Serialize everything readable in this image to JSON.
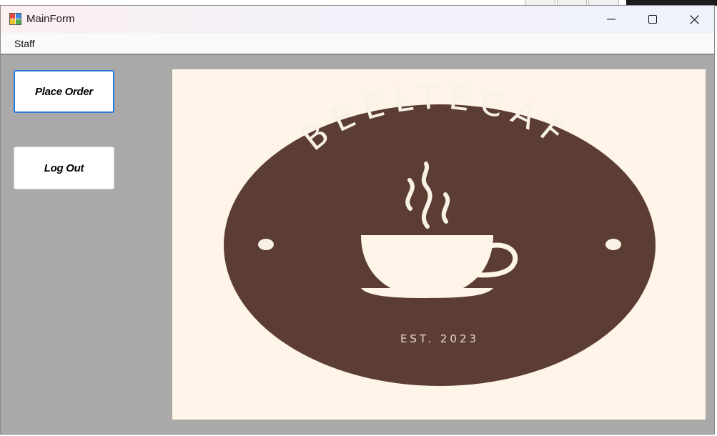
{
  "window": {
    "title": "MainForm",
    "app_icon": "winforms-app-icon",
    "controls": [
      "minimize-icon",
      "maximize-icon",
      "close-icon"
    ]
  },
  "menu": {
    "items": [
      {
        "label": "Staff"
      }
    ]
  },
  "sidebar": {
    "place_order_label": "Place Order",
    "logout_label": "Log Out"
  },
  "logo": {
    "brand": "BEELTECAF",
    "established": "EST. 2023",
    "colors": {
      "background": "#fef4e8",
      "circle": "#5c3d33",
      "cup": "#fef4e8"
    }
  },
  "colors": {
    "client_background": "#a9a9a9",
    "focus_border": "#2a7ad6"
  }
}
